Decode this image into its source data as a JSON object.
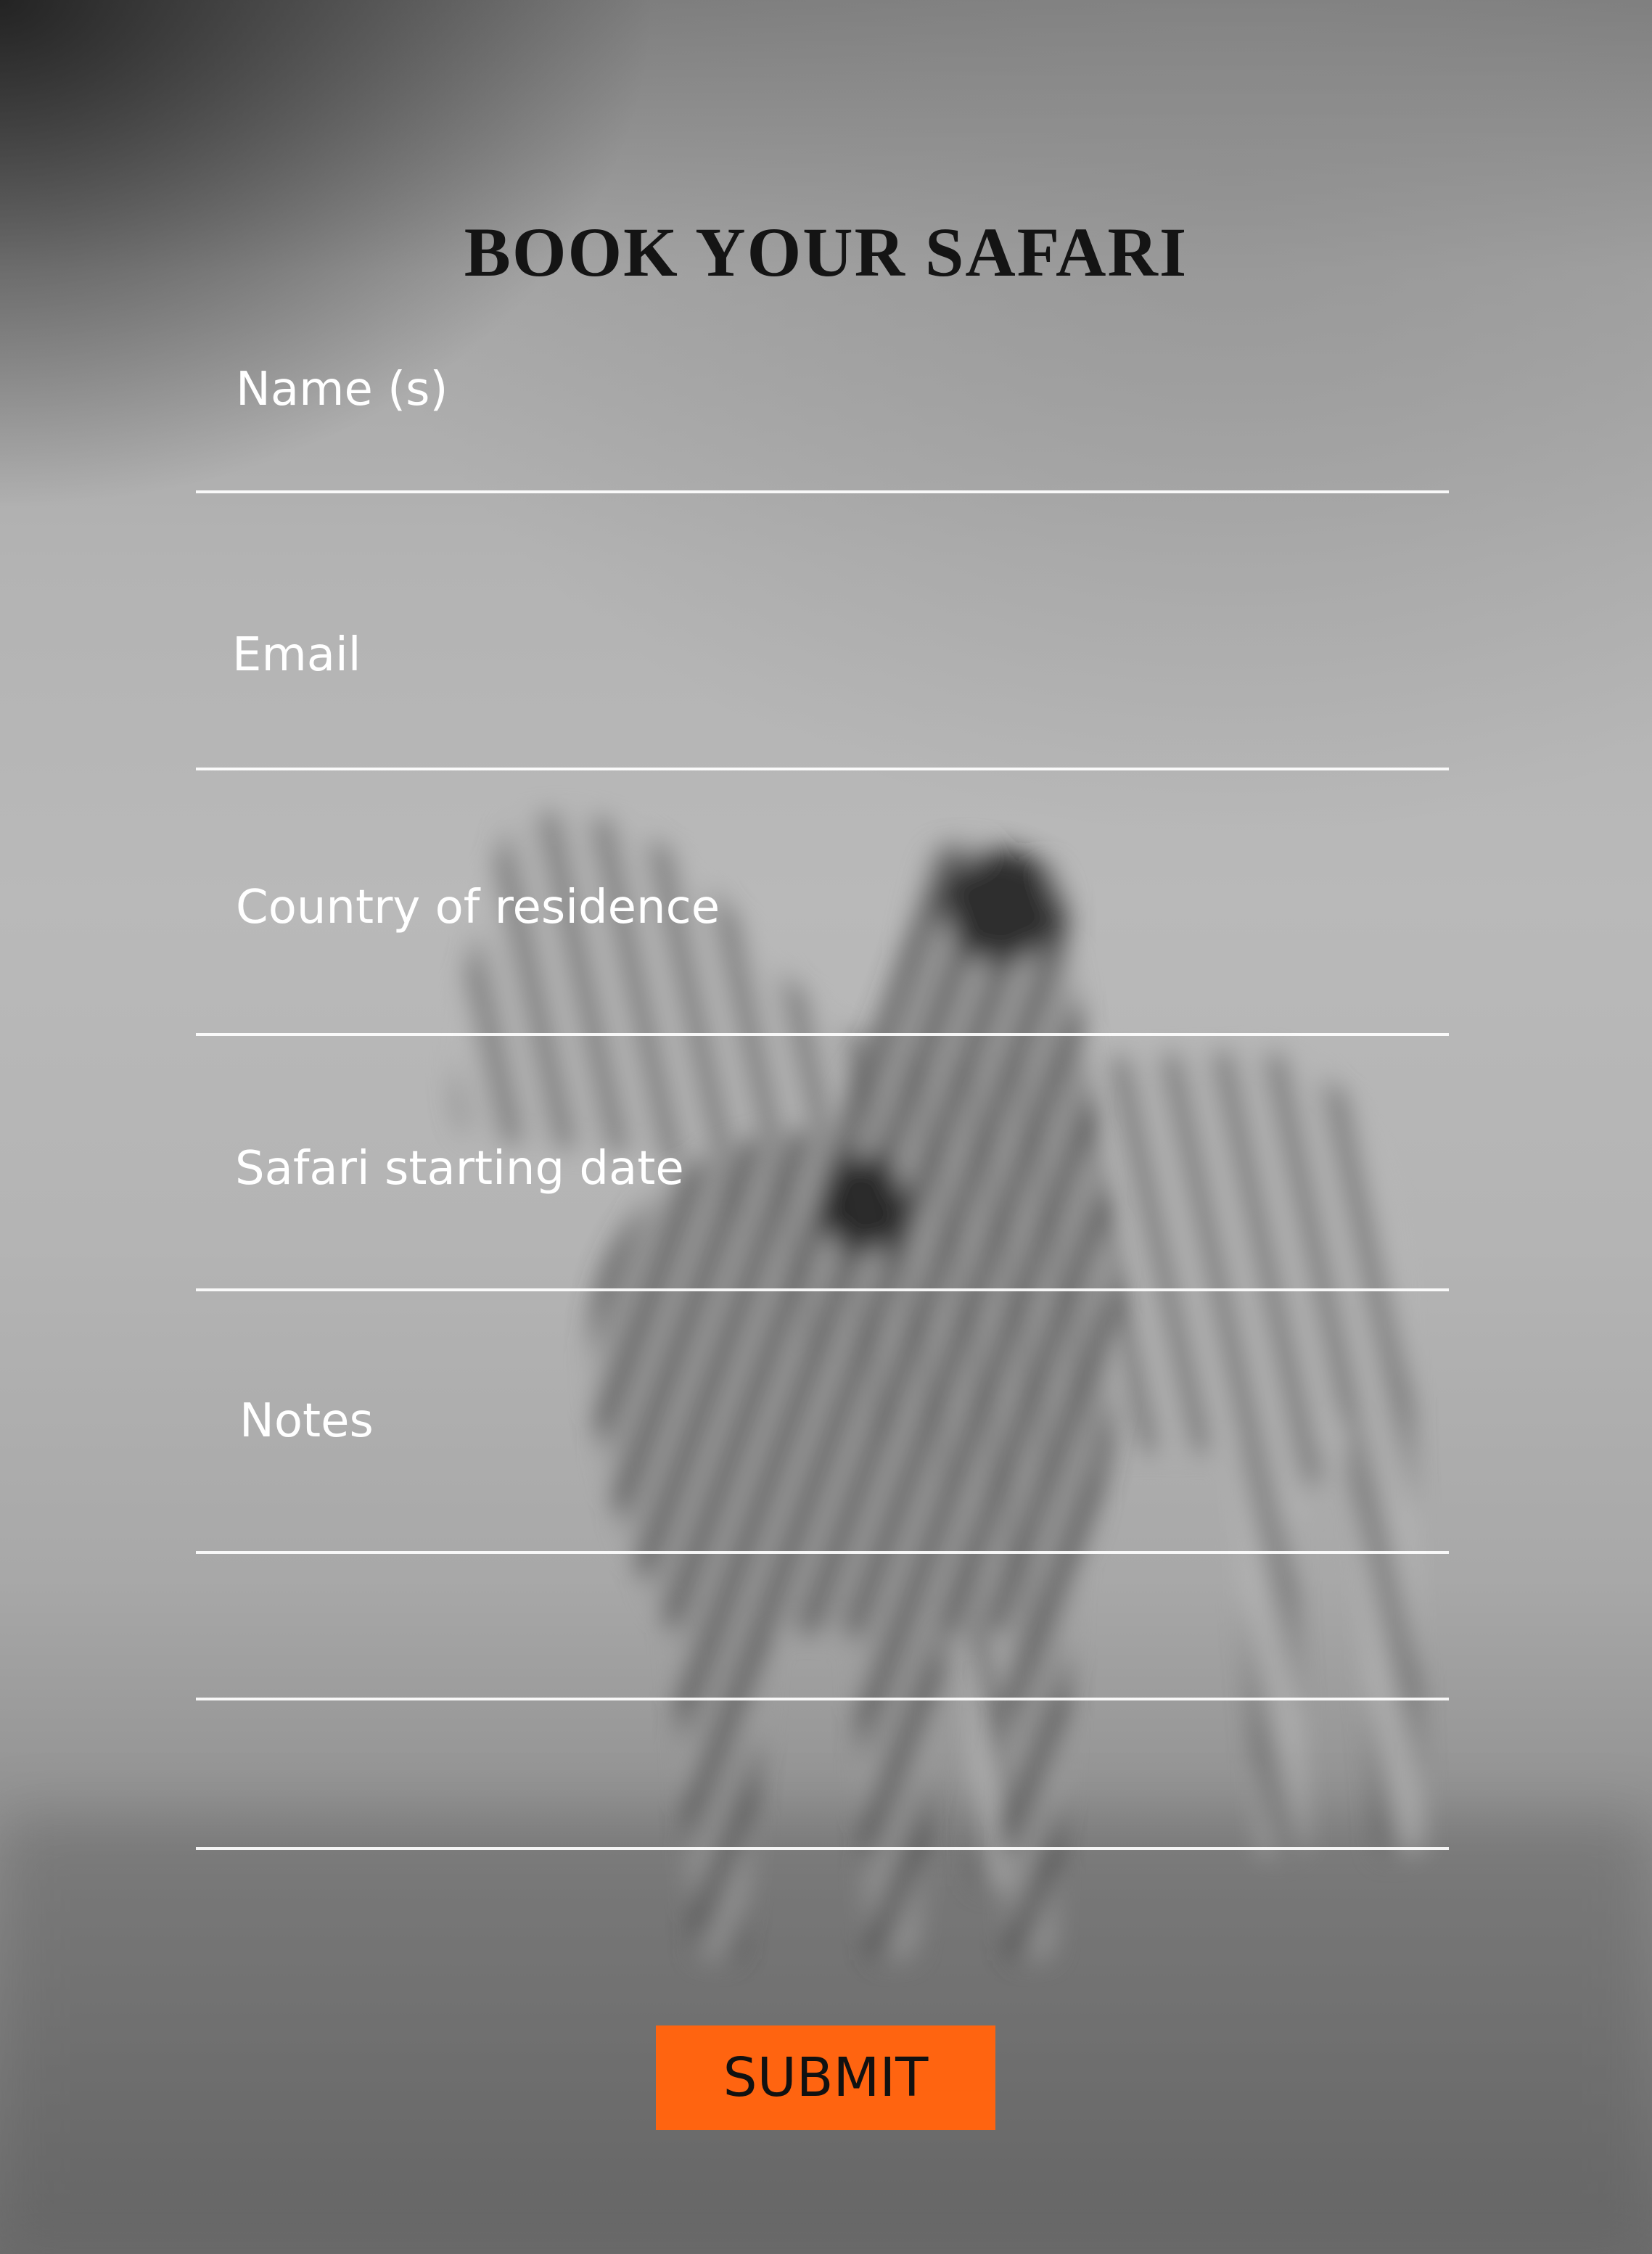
{
  "form": {
    "title": "BOOK YOUR SAFARI",
    "fields": [
      {
        "label": "Name (s)"
      },
      {
        "label": "Email"
      },
      {
        "label": "Country of residence"
      },
      {
        "label": "Safari starting date"
      },
      {
        "label": "Notes"
      }
    ],
    "submit_label": "SUBMIT"
  },
  "colors": {
    "accent": "#ff6410",
    "label_text": "#ffffff",
    "title_text": "#141414"
  },
  "background": {
    "description_icon": "zebras-photo"
  }
}
